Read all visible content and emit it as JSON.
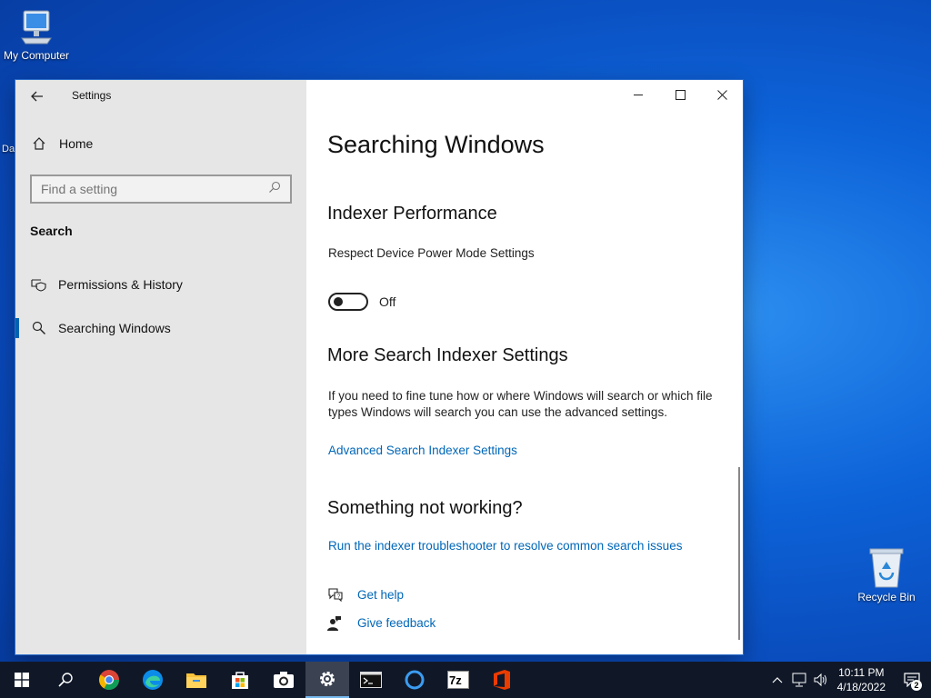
{
  "desktop": {
    "my_computer_label": "My Computer",
    "recycle_bin_label": "Recycle Bin",
    "partial_label": "Da"
  },
  "window": {
    "app_title": "Settings",
    "sidebar": {
      "home_label": "Home",
      "search_placeholder": "Find a setting",
      "section_label": "Search",
      "items": [
        {
          "label": "Permissions & History",
          "icon": "shield-history-icon"
        },
        {
          "label": "Searching Windows",
          "icon": "search-icon",
          "selected": true
        }
      ]
    },
    "content": {
      "page_title": "Searching Windows",
      "indexer_heading": "Indexer Performance",
      "respect_label": "Respect Device Power Mode Settings",
      "toggle_state": "Off",
      "more_heading": "More Search Indexer Settings",
      "more_description": "If you need to fine tune how or where Windows will search or which file types Windows will search you can use the advanced settings.",
      "advanced_link": "Advanced Search Indexer Settings",
      "not_working_heading": "Something not working?",
      "troubleshooter_link": "Run the indexer troubleshooter to resolve common search issues",
      "get_help_link": "Get help",
      "give_feedback_link": "Give feedback"
    }
  },
  "taskbar": {
    "apps": [
      "start-icon",
      "search-icon",
      "chrome-icon",
      "edge-icon",
      "file-explorer-icon",
      "store-icon",
      "camera-icon",
      "settings-icon",
      "terminal-icon",
      "cortana-icon",
      "7zip-icon",
      "office-icon"
    ],
    "time": "10:11 PM",
    "date": "4/18/2022",
    "notification_count": "2",
    "seven_zip_label": "7z"
  },
  "colors": {
    "accent": "#0063b1",
    "link": "#0067b8",
    "sidebar_bg": "#e6e6e6",
    "taskbar_bg": "#101828"
  }
}
